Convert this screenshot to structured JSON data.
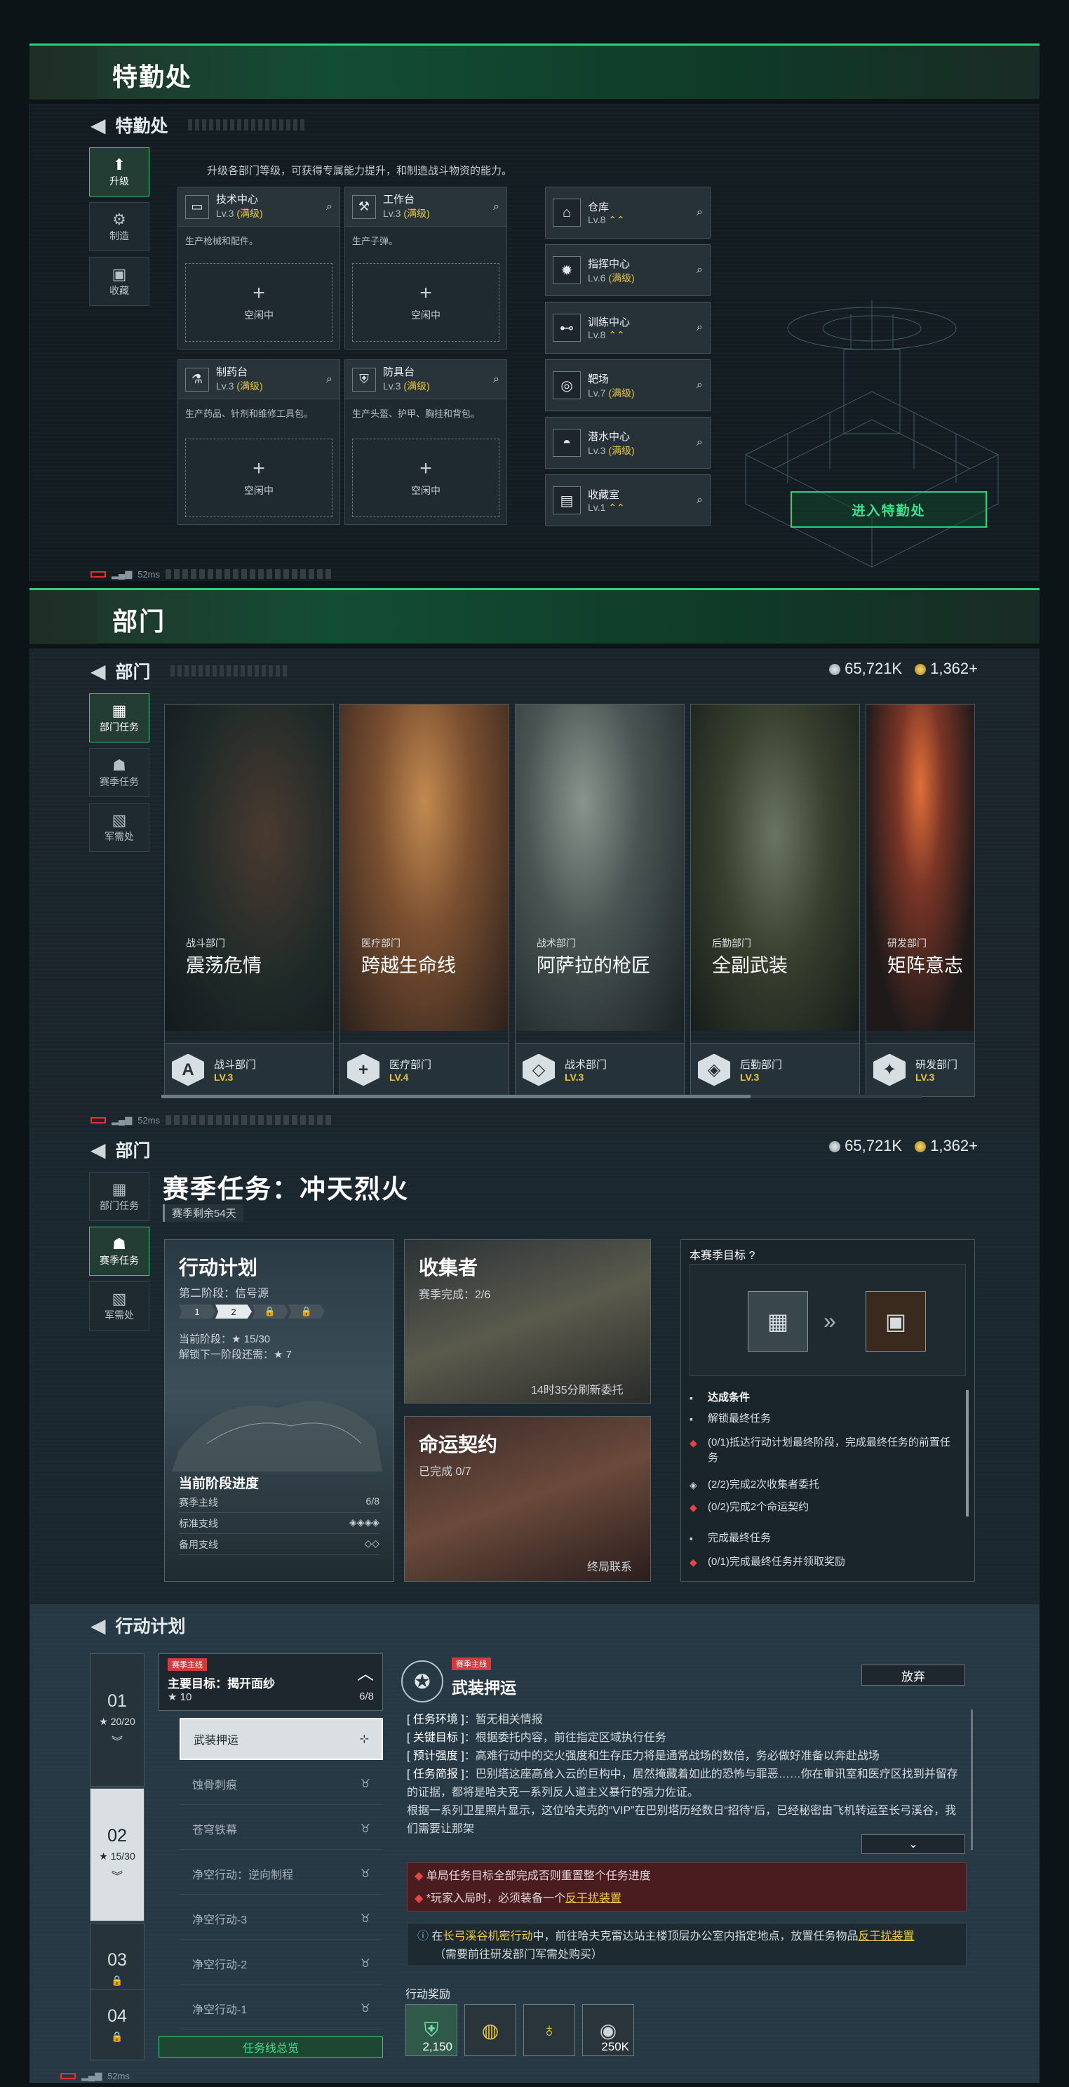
{
  "section1": {
    "banner_title": "特勤处",
    "header": "特勤处",
    "tabs": [
      {
        "label": "升级",
        "icon": "upgrade-icon"
      },
      {
        "label": "制造",
        "icon": "gears-icon"
      },
      {
        "label": "收藏",
        "icon": "collection-icon"
      }
    ],
    "description": "升级各部门等级，可获得专属能力提升，和制造战斗物资的能力。",
    "workshops": [
      {
        "name": "技术中心",
        "level": "Lv.3",
        "max": "(满级)",
        "desc": "生产枪械和配件。",
        "slot": "空闲中"
      },
      {
        "name": "工作台",
        "level": "Lv.3",
        "max": "(满级)",
        "desc": "生产子弹。",
        "slot": "空闲中"
      },
      {
        "name": "制药台",
        "level": "Lv.3",
        "max": "(满级)",
        "desc": "生产药品、针剂和维修工具包。",
        "slot": "空闲中"
      },
      {
        "name": "防具台",
        "level": "Lv.3",
        "max": "(满级)",
        "desc": "生产头盔、护甲、胸挂和背包。",
        "slot": "空闲中"
      }
    ],
    "facilities": [
      {
        "name": "仓库",
        "level": "Lv.8",
        "max": "",
        "up": "⌃⌃"
      },
      {
        "name": "指挥中心",
        "level": "Lv.6",
        "max": "(满级)",
        "up": ""
      },
      {
        "name": "训练中心",
        "level": "Lv.8",
        "max": "",
        "up": "⌃⌃"
      },
      {
        "name": "靶场",
        "level": "Lv.7",
        "max": "(满级)",
        "up": ""
      },
      {
        "name": "潜水中心",
        "level": "Lv.3",
        "max": "(满级)",
        "up": ""
      },
      {
        "name": "收藏室",
        "level": "Lv.1",
        "max": "",
        "up": "⌃⌃"
      }
    ],
    "enter_button": "进入特勤处",
    "ping": "52ms"
  },
  "section2": {
    "banner_title": "部门",
    "header": "部门",
    "currency_silver": "65,721K",
    "currency_gold": "1,362+",
    "tabs": [
      {
        "label": "部门任务"
      },
      {
        "label": "赛季任务"
      },
      {
        "label": "军需处"
      }
    ],
    "departments": [
      {
        "category": "战斗部门",
        "title": "震荡危情",
        "name": "战斗部门",
        "level": "LV.3",
        "icon": "A",
        "art": [
          "#2c3836",
          "#151d1f"
        ]
      },
      {
        "category": "医疗部门",
        "title": "跨越生命线",
        "name": "医疗部门",
        "level": "LV.4",
        "icon": "+",
        "art": [
          "#8a5a34",
          "#3a2a22"
        ]
      },
      {
        "category": "战术部门",
        "title": "阿萨拉的枪匠",
        "name": "战术部门",
        "level": "LV.3",
        "icon": "◇",
        "art": [
          "#5f6a68",
          "#1f2728"
        ]
      },
      {
        "category": "后勤部门",
        "title": "全副武装",
        "name": "后勤部门",
        "level": "LV.3",
        "icon": "◈",
        "art": [
          "#4f5a4a",
          "#1b2320"
        ]
      },
      {
        "category": "研发部门",
        "title": "矩阵意志",
        "name": "研发部门",
        "level": "LV.3",
        "icon": "✦",
        "art": [
          "#6a3a2c",
          "#1e1a1a"
        ]
      }
    ],
    "ping": "52ms"
  },
  "section3": {
    "header": "部门",
    "currency_silver": "65,721K",
    "currency_gold": "1,362+",
    "tabs": [
      {
        "label": "部门任务"
      },
      {
        "label": "赛季任务"
      },
      {
        "label": "军需处"
      }
    ],
    "season_title": "赛季任务：冲天烈火",
    "season_remaining": "赛季剩余54天",
    "action_plan": {
      "title": "行动计划",
      "stage": "第二阶段：信号源",
      "steps": [
        "1",
        "2",
        "🔒",
        "🔒"
      ],
      "current_stage_stars": "当前阶段：★ 15/30",
      "unlock_next": "解锁下一阶段还需：★ 7",
      "progress_title": "当前阶段进度",
      "rows": [
        {
          "label": "赛季主线",
          "value": "6/8"
        },
        {
          "label": "标准支线",
          "value": "◈◈◈◈"
        },
        {
          "label": "备用支线",
          "value": "◇◇"
        }
      ]
    },
    "collector": {
      "title": "收集者",
      "completed": "赛季完成：2/6",
      "refresh": "14时35分刷新委托"
    },
    "fate": {
      "title": "命运契约",
      "completed": "已完成 0/7",
      "contact": "终局联系"
    },
    "goal": {
      "title": "本赛季目标",
      "help": "?",
      "conditions_title": "达成条件",
      "conditions": [
        {
          "mark": "▪",
          "type": "ok",
          "text": "解锁最终任务"
        },
        {
          "mark": "◆",
          "type": "warn",
          "text": "(0/1)抵达行动计划最终阶段，完成最终任务的前置任务"
        },
        {
          "mark": "◈",
          "type": "ok",
          "text": "(2/2)完成2次收集者委托"
        },
        {
          "mark": "◆",
          "type": "warn",
          "text": "(0/2)完成2个命运契约"
        },
        {
          "mark": "▪",
          "type": "ok",
          "text": "完成最终任务"
        },
        {
          "mark": "◆",
          "type": "warn",
          "text": "(0/1)完成最终任务并领取奖励"
        }
      ]
    }
  },
  "section4": {
    "header": "行动计划",
    "chapters": [
      {
        "num": "01",
        "stars": "★ 20/20",
        "locked": false
      },
      {
        "num": "02",
        "stars": "★ 15/30",
        "locked": false
      },
      {
        "num": "03",
        "stars": "🔒",
        "locked": true
      },
      {
        "num": "04",
        "stars": "🔒",
        "locked": true
      }
    ],
    "main_target": {
      "tag": "赛季主线",
      "title": "主要目标：揭开面纱",
      "stars": "★ 10",
      "progress": "6/8"
    },
    "sub_missions": [
      "武装押运",
      "蚀骨刺痕",
      "苍穹铁幕",
      "净空行动：逆向制程",
      "净空行动-3",
      "净空行动-2",
      "净空行动-1"
    ],
    "overview_button": "任务线总览",
    "detail": {
      "tag": "赛季主线",
      "title": "武装押运",
      "abandon": "放弃",
      "info": [
        {
          "k": "[ 任务环境 ]",
          "v": "：暂无相关情报"
        },
        {
          "k": "[ 关键目标 ]",
          "v": "：根据委托内容，前往指定区域执行任务"
        },
        {
          "k": "[ 预计强度 ]",
          "v": "：高难行动中的交火强度和生存压力将是通常战场的数倍，务必做好准备以奔赴战场"
        },
        {
          "k": "[ 任务简报 ]",
          "v": "：巴别塔这座高耸入云的巨构中，居然掩藏着如此的恐怖与罪恶……你在审讯室和医疗区找到并留存的证据，都将是哈夫克一系列反人道主义暴行的强力佐证。"
        },
        {
          "k": "",
          "v": "根据一系列卫星照片显示，这位哈夫克的“VIP”在巴别塔历经数日“招待”后，已经秘密由飞机转运至长弓溪谷，我们需要让那架"
        }
      ],
      "warn1": "单局任务目标全部完成否则重置整个任务进度",
      "warn2_prefix": "*玩家入局时，必须装备一个",
      "warn2_link": "反干扰装置",
      "hint_prefix": "在",
      "hint_link1": "长弓溪谷机密行动",
      "hint_mid": "中，前往哈夫克雷达站主楼顶层办公室内指定地点，放置任务物品",
      "hint_link2": "反干扰装置",
      "hint_suffix": "（需要前往研发部门军需处购买）",
      "rewards_label": "行动奖励",
      "rewards": [
        {
          "icon": "medal-icon",
          "count": "2,150"
        },
        {
          "icon": "ring-icon",
          "count": ""
        },
        {
          "icon": "pendant-icon",
          "count": ""
        },
        {
          "icon": "coin-icon",
          "count": "250K"
        }
      ]
    },
    "ping": "52ms"
  }
}
